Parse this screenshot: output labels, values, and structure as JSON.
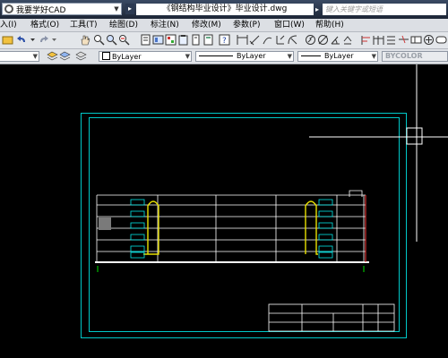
{
  "app": {
    "workspace": "我要学好CAD",
    "doc_title": "《钢结构毕业设计》毕业设计.dwg",
    "search_placeholder": "键入关键字或短语"
  },
  "menu": [
    {
      "label": "入(I)"
    },
    {
      "label": "格式(O)"
    },
    {
      "label": "工具(T)"
    },
    {
      "label": "绘图(D)"
    },
    {
      "label": "标注(N)"
    },
    {
      "label": "修改(M)"
    },
    {
      "label": "参数(P)"
    },
    {
      "label": "窗口(W)"
    },
    {
      "label": "帮助(H)"
    }
  ],
  "properties": {
    "color": "ByLayer",
    "linetype": "ByLayer",
    "lineweight": "ByLayer",
    "plotstyle": "BYCOLOR"
  },
  "colors": {
    "canvas": "#000000",
    "frame": "#00c8c8",
    "annotation": "#00e6e6",
    "column": "#e8e000",
    "lines": "#ffffff",
    "accent_red": "#ff3c3c",
    "ground_marks": "#00e000"
  }
}
